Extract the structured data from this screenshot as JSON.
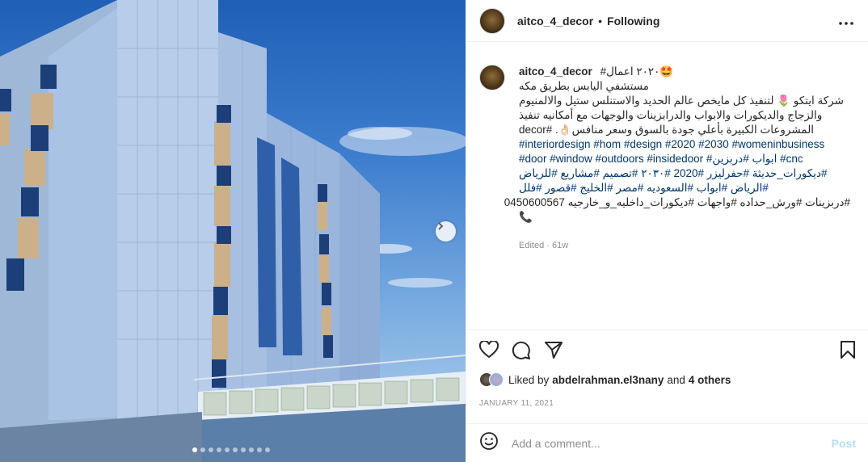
{
  "header": {
    "username": "aitco_4_decor",
    "separator": "•",
    "follow_status": "Following",
    "more_label": "•••"
  },
  "caption": {
    "username": "aitco_4_decor",
    "lines": [
      "#٢٠٢٠ اعمال🤩",
      "مستشفي اليابس بطريق مكه",
      "شركة ايتكو 🌷 لتنفيذ كل مايخص عالم الحديد والاستنلس ستيل والالمنيوم",
      "والزجاج والديكورات والابواب والدرابزينات والوجهات مع أمكانيه تنفيذ",
      "المشروعات الكبيرة بأعلي جودة بالسوق وسعر منافس👌🏻. #decor",
      "#interiordesign #hom #design #2020 #2030 #womeninbusiness",
      "#door #window #outdoors #insidedoor #ابواب #دربزين #cnc",
      "#ديكورات_حديثة #حفرليزر #2020 #٢٠٣٠ #تصميم #مشاريع #للرياض",
      "#الرياض #ابواب #السعوديه #مصر #الخليج #قصور #فلل",
      "#دربزينات #ورش_حداده #واجهات #ديكورات_داخليه_و_خارجيه 0450600567",
      "📞"
    ],
    "edited": "Edited · 61w"
  },
  "likes": {
    "prefix": "Liked by",
    "user": "abdelrahman.el3nany",
    "conj": "and",
    "others": "4 others"
  },
  "date": "JANUARY 11, 2021",
  "comment": {
    "placeholder": "Add a comment...",
    "post_label": "Post"
  },
  "carousel": {
    "total": 10,
    "active": 1
  },
  "icons": {
    "like": "heart-icon",
    "comment": "comment-icon",
    "share": "paper-plane-icon",
    "save": "bookmark-icon",
    "emoji": "smiley-icon",
    "next": "chevron-right-icon"
  },
  "colors": {
    "hashtag": "#00376b",
    "post_disabled": "#b2dffc",
    "meta_gray": "#8e8e8e"
  }
}
